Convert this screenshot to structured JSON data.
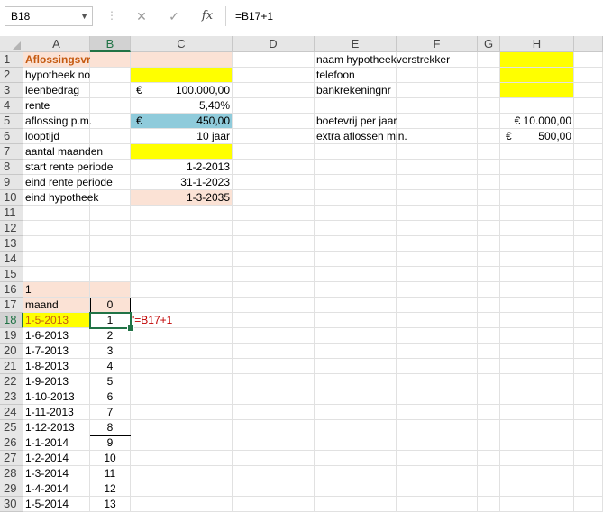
{
  "formula_bar": {
    "name_box": "B18",
    "cancel_icon": "✕",
    "enter_icon": "✓",
    "fx_label": "fx",
    "formula": "=B17+1"
  },
  "columns": [
    "A",
    "B",
    "C",
    "D",
    "E",
    "F",
    "G",
    "H"
  ],
  "rows": [
    "1",
    "2",
    "3",
    "4",
    "5",
    "6",
    "7",
    "8",
    "9",
    "10",
    "11",
    "12",
    "13",
    "14",
    "15",
    "16",
    "17",
    "18",
    "19",
    "20",
    "21",
    "22",
    "23",
    "24",
    "25",
    "26",
    "27",
    "28",
    "29",
    "30"
  ],
  "cells": {
    "A1": "Aflossingsvrij",
    "A2": "hypotheek no",
    "A3": "leenbedrag",
    "A4": "rente",
    "A5": "aflossing p.m.",
    "A6": "looptijd",
    "A7": "aantal maanden",
    "A8": "start rente periode",
    "A9": "eind rente periode",
    "A10": "eind hypotheek",
    "C3_cur": "€",
    "C3": "100.000,00",
    "C4": "5,40%",
    "C5_cur": "€",
    "C5": "450,00",
    "C6": "10 jaar",
    "C8": "1-2-2013",
    "C9": "31-1-2023",
    "C10": "1-3-2035",
    "E1": "naam hypotheekverstrekker",
    "E2": "telefoon",
    "E3": "bankrekeningnr",
    "E5": "boetevrij per jaar",
    "E6": "extra aflossen min.",
    "H5": "€ 10.000,00",
    "H6_cur": "€",
    "H6": "500,00",
    "A16": "1",
    "A17": "maand",
    "B17": "0",
    "C18": "'=B17+1"
  },
  "schedule": [
    {
      "date": "1-5-2013",
      "n": "1"
    },
    {
      "date": "1-6-2013",
      "n": "2"
    },
    {
      "date": "1-7-2013",
      "n": "3"
    },
    {
      "date": "1-8-2013",
      "n": "4"
    },
    {
      "date": "1-9-2013",
      "n": "5"
    },
    {
      "date": "1-10-2013",
      "n": "6"
    },
    {
      "date": "1-11-2013",
      "n": "7"
    },
    {
      "date": "1-12-2013",
      "n": "8"
    },
    {
      "date": "1-1-2014",
      "n": "9"
    },
    {
      "date": "1-2-2014",
      "n": "10"
    },
    {
      "date": "1-3-2014",
      "n": "11"
    },
    {
      "date": "1-4-2014",
      "n": "12"
    },
    {
      "date": "1-5-2014",
      "n": "13"
    }
  ],
  "colors": {
    "peach": "#fbe2d5",
    "yellow": "#ffff00",
    "blue": "#8fcbdb",
    "excel_green": "#217346"
  }
}
